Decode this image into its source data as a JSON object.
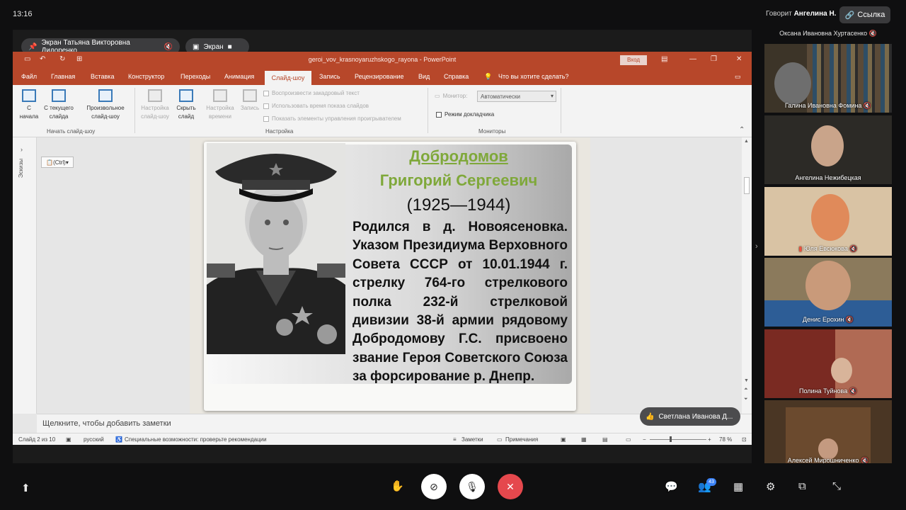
{
  "status": {
    "time": "13:16",
    "speaking_prefix": "Говорит",
    "speaking_name": "Ангелина Н.",
    "link_label": "Ссылка"
  },
  "screen_chip": {
    "label": "Экран Татьяна Викторовна Дидоренко",
    "screen_label": "Экран"
  },
  "ppt": {
    "title": "geroi_vov_krasnoyaruzhskogo_rayona - PowerPoint",
    "login": "Вход",
    "tabs": [
      "Файл",
      "Главная",
      "Вставка",
      "Конструктор",
      "Переходы",
      "Анимация",
      "Слайд-шоу",
      "Запись",
      "Рецензирование",
      "Вид",
      "Справка"
    ],
    "active_tab": "Слайд-шоу",
    "tell_me": "Что вы хотите сделать?",
    "ribbon": {
      "from_start": "С начала",
      "from_current": "С текущего слайда",
      "custom_show": "Произвольное слайд-шоу",
      "group_start": "Начать слайд-шоу",
      "setup_show": "Настройка слайд-шоу",
      "hide_slide": "Скрыть слайд",
      "rehearse": "Настройка времени",
      "record": "Запись",
      "chk_narration": "Воспроизвести закадровый текст",
      "chk_timings": "Использовать время показа слайдов",
      "chk_controls": "Показать элементы управления проигрывателем",
      "group_setup": "Настройка",
      "monitor_label": "Монитор:",
      "monitor_value": "Автоматически",
      "presenter_view": "Режим докладчика",
      "group_monitors": "Мониторы"
    },
    "thumbs_label": "Эскизы",
    "ctrl_tag": "(Ctrl)",
    "slide": {
      "name_line1": "Добродомов",
      "name_line2": "Григорий Сергеевич",
      "years": "(1925—1944)",
      "body": "Родился в д. Новоясеновка. Указом Президиума Верховного Совета СССР от 10.01.1944 г. стрелку 764-го стрелкового полка 232-й стрелковой дивизии 38-й армии рядовому Добродомову Г.С. присвоено звание Героя Советского Союза за форсирование р. Днепр."
    },
    "notes_placeholder": "Щелкните, чтобы добавить заметки",
    "statusbar": {
      "slide": "Слайд 2 из 10",
      "language": "русский",
      "accessibility": "Специальные возможности: проверьте рекомендации",
      "notes": "Заметки",
      "comments": "Примечания",
      "zoom": "78 %"
    }
  },
  "reaction": {
    "name": "Светлана Иванова Д..."
  },
  "participants": [
    {
      "name": "Оксана Ивановна Хуртасенко"
    },
    {
      "name": "Галина Ивановна Фомина"
    },
    {
      "name": "Ангелина Нежибецкая"
    },
    {
      "name": "Юля Евсюкова"
    },
    {
      "name": "Денис Ерохин"
    },
    {
      "name": "Полина Туйнова"
    },
    {
      "name": "Алексей Мирошниченко"
    }
  ],
  "toolbar": {
    "participants_count": "43"
  }
}
